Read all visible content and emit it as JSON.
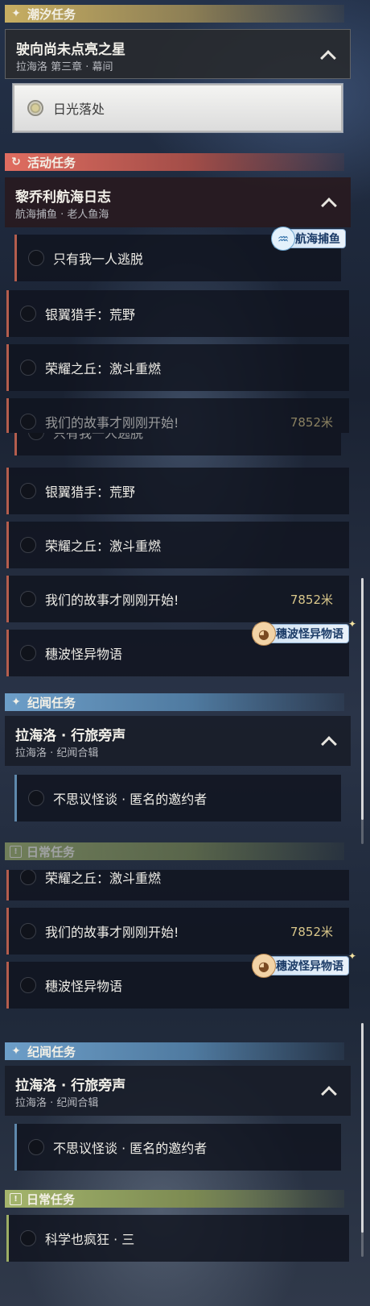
{
  "sections": {
    "tide": "潮汐任务",
    "activity": "活动任务",
    "lore": "纪闻任务",
    "daily": "日常任务"
  },
  "groups": {
    "star": {
      "title": "驶向尚未点亮之星",
      "subtitle": "拉海洛 第三章 · 幕间"
    },
    "log": {
      "title": "黎乔利航海日志",
      "subtitle": "航海捕鱼 · 老人鱼海"
    },
    "voice": {
      "title": "拉海洛 · 行旅旁声",
      "subtitle": "拉海洛 · 纪闻合辑"
    }
  },
  "quests": {
    "sunlight": "日光落处",
    "escape": "只有我一人逃脱",
    "silverwing": "银翼猎手：荒野",
    "glory": "荣耀之丘：激斗重燃",
    "story": "我们的故事才刚刚开始!",
    "story_distance": "7852米",
    "suibo": "穗波怪异物语",
    "invite": "不思议怪谈 · 匿名的邀约者",
    "science": "科学也疯狂 · 三"
  },
  "tags": {
    "fishing": "航海捕鱼",
    "suibo": "穗波怪异物语"
  },
  "icons": {
    "tide": "sparkle-star-icon",
    "activity": "swirl-icon",
    "lore": "sparkle-star-icon",
    "daily": "exclamation-box-icon",
    "expand": "chevron-up-icon"
  },
  "colors": {
    "tide": "#c7ae62",
    "activity": "#e06d60",
    "lore": "#6d9ec8",
    "daily": "#a4b56c",
    "distance": "#d8c68a"
  }
}
